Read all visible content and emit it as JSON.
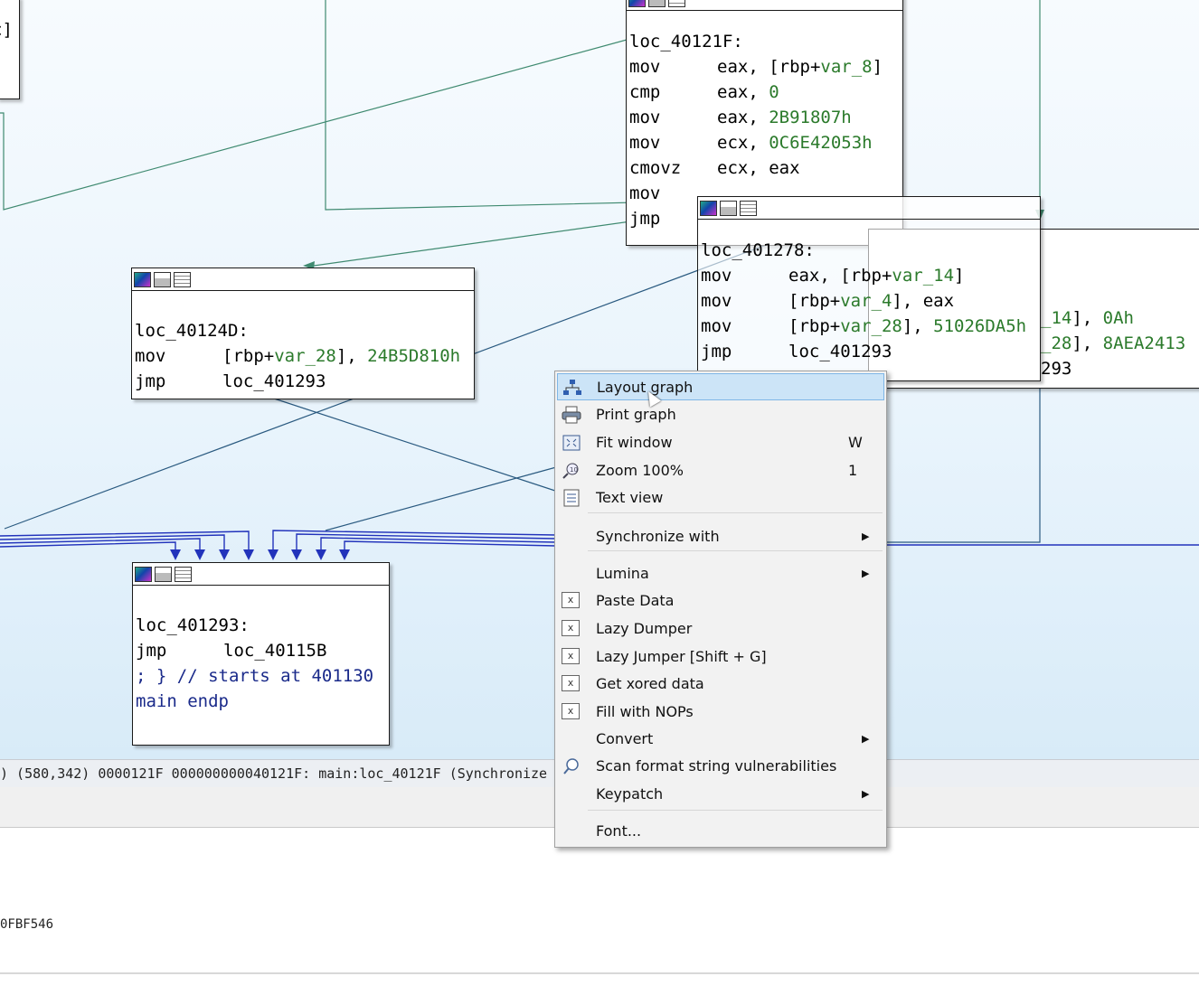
{
  "graph": {
    "nodes": {
      "n121f": {
        "lines": [
          {
            "label": "loc_40121F:"
          },
          {
            "mn": "mov",
            "a": "eax, [rbp+",
            "b": "var_8",
            "c": "]"
          },
          {
            "mn": "cmp",
            "a": "eax, ",
            "b": "0",
            "c": ""
          },
          {
            "mn": "mov",
            "a": "eax, ",
            "b": "2B91807h",
            "c": ""
          },
          {
            "mn": "mov",
            "a": "ecx, ",
            "b": "0C6E42053h",
            "c": ""
          },
          {
            "mn": "cmovz",
            "a": "ecx, eax",
            "b": "",
            "c": ""
          },
          {
            "mn": "mov",
            "a": "",
            "b": "",
            "c": ""
          },
          {
            "mn": "jmp",
            "a": "",
            "b": "",
            "c": ""
          }
        ]
      },
      "n1278": {
        "lines": [
          {
            "label": "loc_401278:"
          },
          {
            "mn": "mov",
            "a": "eax, [rbp+",
            "b": "var_14",
            "c": "]"
          },
          {
            "mn": "mov",
            "a": "[rbp+",
            "b": "var_4",
            "c": "], eax"
          },
          {
            "mn": "mov",
            "a": "[rbp+",
            "b": "var_28",
            "c": "], ",
            "d": "51026DA5h"
          },
          {
            "mn": "jmp",
            "a": "loc_401293",
            "b": "",
            "c": ""
          }
        ]
      },
      "nright": {
        "lines": [
          {
            "pre": "",
            "b": "_14",
            "c": "], ",
            "d": "0Ah"
          },
          {
            "pre": "",
            "b": "_28",
            "c": "], ",
            "d": "8AEA2413"
          },
          {
            "pre": "",
            "b": "",
            "c": "293",
            "d": ""
          }
        ]
      },
      "n124d": {
        "lines": [
          {
            "label": "loc_40124D:"
          },
          {
            "mn": "mov",
            "a": "[rbp+",
            "b": "var_28",
            "c": "], ",
            "d": "24B5D810h"
          },
          {
            "mn": "jmp",
            "a": "loc_401293",
            "b": "",
            "c": ""
          }
        ]
      },
      "n1293": {
        "lines": [
          {
            "label": "loc_401293:"
          },
          {
            "mn": "jmp",
            "a": "loc_40115B",
            "b": "",
            "c": ""
          },
          {
            "comment": "; } // starts at 401130"
          },
          {
            "comment": "main endp"
          }
        ]
      },
      "nleft": {
        "text": "c]"
      }
    }
  },
  "statusbar": {
    "text": ") (580,342) 0000121F 000000000040121F: main:loc_40121F (Synchronize"
  },
  "output": {
    "line": "0FBF546"
  },
  "context_menu": {
    "items": [
      {
        "label": "Layout graph",
        "shortcut": "",
        "submenu": false,
        "icon": "layout-graph-icon",
        "highlighted": true
      },
      {
        "label": "Print graph",
        "shortcut": "",
        "submenu": false,
        "icon": "printer-icon"
      },
      {
        "label": "Fit window",
        "shortcut": "W",
        "submenu": false,
        "icon": "fit-window-icon"
      },
      {
        "label": "Zoom 100%",
        "shortcut": "1",
        "submenu": false,
        "icon": "zoom-icon"
      },
      {
        "label": "Text view",
        "shortcut": "",
        "submenu": false,
        "icon": "text-view-icon"
      },
      {
        "label": "Synchronize with",
        "shortcut": "",
        "submenu": true,
        "icon": ""
      },
      {
        "label": "Lumina",
        "shortcut": "",
        "submenu": true,
        "icon": ""
      },
      {
        "label": "Paste Data",
        "shortcut": "",
        "submenu": false,
        "icon": "plugin-icon"
      },
      {
        "label": "Lazy Dumper",
        "shortcut": "",
        "submenu": false,
        "icon": "plugin-icon"
      },
      {
        "label": "Lazy Jumper [Shift + G]",
        "shortcut": "",
        "submenu": false,
        "icon": "plugin-icon"
      },
      {
        "label": "Get xored data",
        "shortcut": "",
        "submenu": false,
        "icon": "plugin-icon"
      },
      {
        "label": "Fill with NOPs",
        "shortcut": "",
        "submenu": false,
        "icon": "plugin-icon"
      },
      {
        "label": "Convert",
        "shortcut": "",
        "submenu": true,
        "icon": ""
      },
      {
        "label": "Scan format string vulnerabilities",
        "shortcut": "",
        "submenu": false,
        "icon": "search-icon"
      },
      {
        "label": "Keypatch",
        "shortcut": "",
        "submenu": true,
        "icon": ""
      },
      {
        "label": "Font...",
        "shortcut": "",
        "submenu": false,
        "icon": ""
      }
    ],
    "plugin_icon_text": "x"
  },
  "colors": {
    "operand_green": "#2b7a2b",
    "comment_blue": "#1a2a8a",
    "edge_green": "#3f8a70",
    "edge_blue": "#2233bb",
    "menu_highlight": "#cce4f7"
  }
}
